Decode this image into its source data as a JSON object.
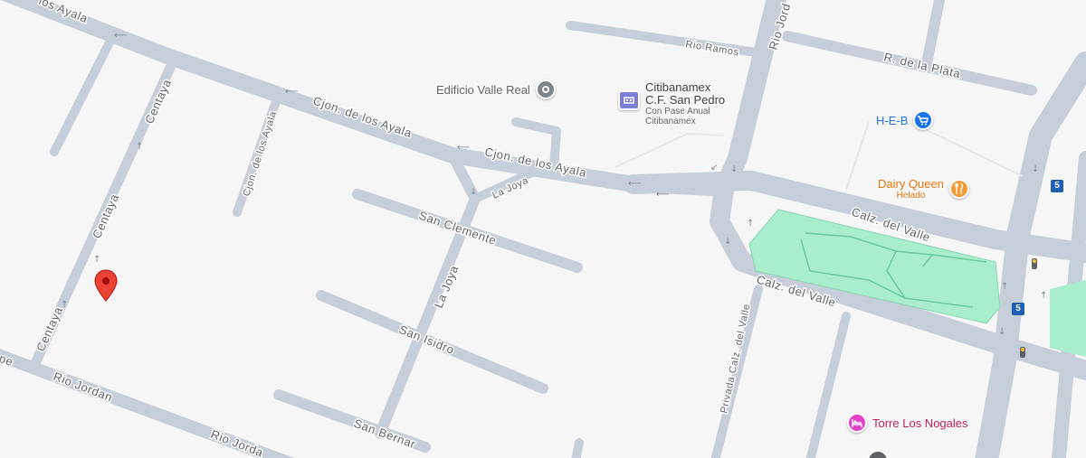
{
  "map": {
    "streets": [
      {
        "key": "cjon_ayala_top",
        "label": "Cjon. de los Ayala"
      },
      {
        "key": "cjon_ayala_mid",
        "label": "Cjon. de los Ayala"
      },
      {
        "key": "los_ayala_topleft",
        "label": "los Ayala"
      },
      {
        "key": "centaya_top",
        "label": "Centaya"
      },
      {
        "key": "centaya_mid",
        "label": "Centaya"
      },
      {
        "key": "centaya_low",
        "label": "Centaya"
      },
      {
        "key": "cjon_de_los_ayala_vert",
        "label": "Cjon. de los Ayala"
      },
      {
        "key": "la_joya_small",
        "label": "La Joya"
      },
      {
        "key": "la_joya",
        "label": "La Joya"
      },
      {
        "key": "san_clemente",
        "label": "San Clemente"
      },
      {
        "key": "san_isidro",
        "label": "San Isidro"
      },
      {
        "key": "san_bernardo",
        "label": "San Bernar"
      },
      {
        "key": "rio_jordan_1",
        "label": "Rio Jordan"
      },
      {
        "key": "rio_jordan_2",
        "label": "Rio Jorda"
      },
      {
        "key": "pe_edge",
        "label": "pe"
      },
      {
        "key": "rio_ramos",
        "label": "Rio Ramos"
      },
      {
        "key": "rio_jordan_vert",
        "label": "Rio Jord"
      },
      {
        "key": "r_de_la_plata",
        "label": "R. de la Plata"
      },
      {
        "key": "calz_del_valle_1",
        "label": "Calz. del Valle"
      },
      {
        "key": "calz_del_valle_2",
        "label": "Calz. del Valle"
      },
      {
        "key": "privada_calz",
        "label": "Privada Calz. del Valle"
      }
    ],
    "pois": {
      "edificio": {
        "name": "Edificio Valle Real",
        "icon": "landmark-icon",
        "color": "#5f6368"
      },
      "citibanamex": {
        "name1": "Citibanamex",
        "name2": "C.F. San Pedro",
        "sub1": "Con Pase Anual",
        "sub2": "Citibanamex",
        "icon": "atm-icon",
        "color": "#3c4043",
        "icon_color": "#7b7fd6"
      },
      "heb": {
        "name": "H-E-B",
        "icon": "shopping-cart-icon",
        "color": "#1a73e8"
      },
      "dairy_queen": {
        "name": "Dairy Queen",
        "sub": "Helado",
        "icon": "restaurant-icon",
        "color": "#e8710a"
      },
      "torre": {
        "name": "Torre Los Nogales",
        "icon": "hotel-icon",
        "color": "#c2185b"
      }
    },
    "route_shields": [
      {
        "key": "shield_top",
        "label": "5"
      },
      {
        "key": "shield_bottom",
        "label": "5"
      }
    ],
    "colors": {
      "road": "#c5cdd8",
      "background": "#f6f6f6",
      "park": "#a8edcc",
      "marker": "#ea4335"
    }
  }
}
